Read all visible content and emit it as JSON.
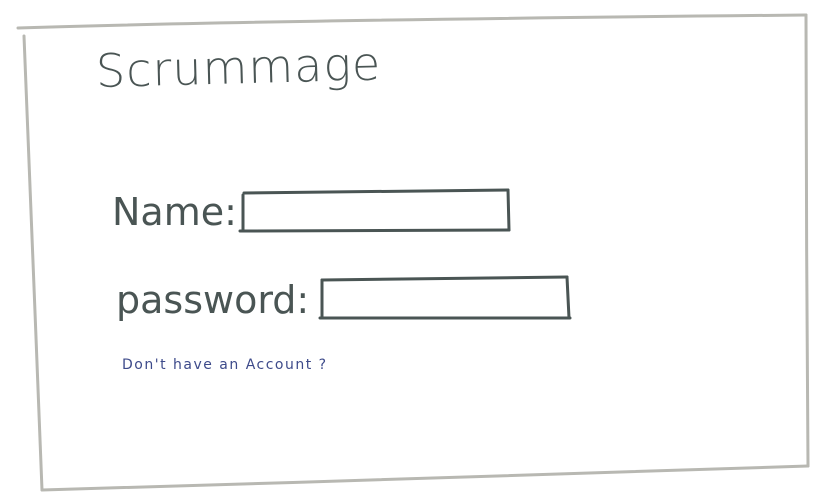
{
  "app": {
    "title": "Scrummage"
  },
  "login_form": {
    "name_label": "Name:",
    "name_value": "",
    "password_label": "password:",
    "password_value": "",
    "signup_link": "Don't have an Account ?"
  },
  "colors": {
    "ink": "#4a5554",
    "frame": "#b8b8b2",
    "link": "#3d4a8a",
    "background": "#ffffff"
  }
}
